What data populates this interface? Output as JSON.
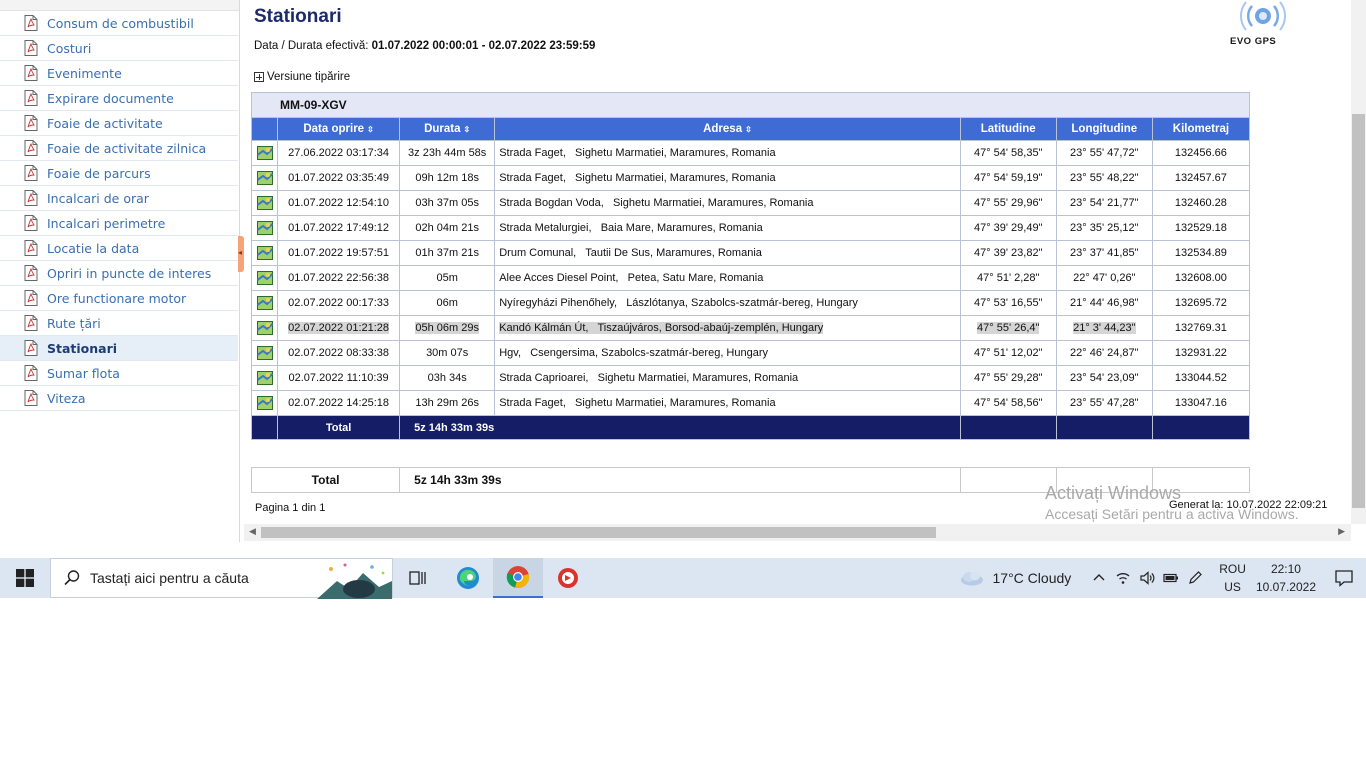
{
  "sidebar": {
    "items": [
      {
        "label": "Consum de combustibil",
        "active": false
      },
      {
        "label": "Costuri",
        "active": false
      },
      {
        "label": "Evenimente",
        "active": false
      },
      {
        "label": "Expirare documente",
        "active": false
      },
      {
        "label": "Foaie de activitate",
        "active": false
      },
      {
        "label": "Foaie de activitate zilnica",
        "active": false
      },
      {
        "label": "Foaie de parcurs",
        "active": false
      },
      {
        "label": "Incalcari de orar",
        "active": false
      },
      {
        "label": "Incalcari perimetre",
        "active": false
      },
      {
        "label": "Locatie la data",
        "active": false
      },
      {
        "label": "Opriri in puncte de interes",
        "active": false
      },
      {
        "label": "Ore functionare motor",
        "active": false
      },
      {
        "label": "Rute țări",
        "active": false
      },
      {
        "label": "Stationari",
        "active": true
      },
      {
        "label": "Sumar flota",
        "active": false
      },
      {
        "label": "Viteza",
        "active": false
      }
    ]
  },
  "page": {
    "title": "Stationari",
    "date_label": "Data / Durata efectivă:",
    "date_value": "01.07.2022 00:00:01 - 02.07.2022 23:59:59",
    "print_version": "Versiune tipărire",
    "logo_text": "EVO GPS",
    "pagination": "Pagina 1 din 1",
    "generated": "Generat la: 10.07.2022 22:09:21"
  },
  "report": {
    "vehicle": "MM-09-XGV",
    "columns": [
      "Data oprire",
      "Durata",
      "Adresa",
      "Latitudine",
      "Longitudine",
      "Kilometraj"
    ],
    "sort_glyph": "⇳",
    "rows": [
      {
        "date": "27.06.2022 03:17:34",
        "duration": "3z 23h 44m 58s",
        "address": "Strada Faget,   Sighetu Marmatiei, Maramures, Romania",
        "lat": "47° 54' 58,35\"",
        "lon": "23° 55' 47,72\"",
        "km": "132456.66",
        "highlight": false
      },
      {
        "date": "01.07.2022 03:35:49",
        "duration": "09h 12m 18s",
        "address": "Strada Faget,   Sighetu Marmatiei, Maramures, Romania",
        "lat": "47° 54' 59,19\"",
        "lon": "23° 55' 48,22\"",
        "km": "132457.67",
        "highlight": false
      },
      {
        "date": "01.07.2022 12:54:10",
        "duration": "03h 37m 05s",
        "address": "Strada Bogdan Voda,   Sighetu Marmatiei, Maramures, Romania",
        "lat": "47° 55' 29,96\"",
        "lon": "23° 54' 21,77\"",
        "km": "132460.28",
        "highlight": false
      },
      {
        "date": "01.07.2022 17:49:12",
        "duration": "02h 04m 21s",
        "address": "Strada Metalurgiei,   Baia Mare, Maramures, Romania",
        "lat": "47° 39' 29,49\"",
        "lon": "23° 35' 25,12\"",
        "km": "132529.18",
        "highlight": false
      },
      {
        "date": "01.07.2022 19:57:51",
        "duration": "01h 37m 21s",
        "address": "Drum Comunal,   Tautii De Sus, Maramures, Romania",
        "lat": "47° 39' 23,82\"",
        "lon": "23° 37' 41,85\"",
        "km": "132534.89",
        "highlight": false
      },
      {
        "date": "01.07.2022 22:56:38",
        "duration": "05m",
        "address": "Alee Acces Diesel Point,   Petea, Satu Mare, Romania",
        "lat": "47° 51' 2,28\"",
        "lon": "22° 47' 0,26\"",
        "km": "132608.00",
        "highlight": false
      },
      {
        "date": "02.07.2022 00:17:33",
        "duration": "06m",
        "address": "Nyíregyházi Pihenőhely,   Lászlótanya, Szabolcs-szatmár-bereg, Hungary",
        "lat": "47° 53' 16,55\"",
        "lon": "21° 44' 46,98\"",
        "km": "132695.72",
        "highlight": false
      },
      {
        "date": "02.07.2022 01:21:28",
        "duration": "05h 06m 29s",
        "address": "Kandó Kálmán Út,   Tiszaújváros, Borsod-abaúj-zemplén, Hungary",
        "lat": "47° 55' 26,4\"",
        "lon": "21° 3' 44,23\"",
        "km": "132769.31",
        "highlight": true
      },
      {
        "date": "02.07.2022 08:33:38",
        "duration": "30m 07s",
        "address": "Hgv,   Csengersima, Szabolcs-szatmár-bereg, Hungary",
        "lat": "47° 51' 12,02\"",
        "lon": "22° 46' 24,87\"",
        "km": "132931.22",
        "highlight": false
      },
      {
        "date": "02.07.2022 11:10:39",
        "duration": "03h 34s",
        "address": "Strada Caprioarei,   Sighetu Marmatiei, Maramures, Romania",
        "lat": "47° 55' 29,28\"",
        "lon": "23° 54' 23,09\"",
        "km": "133044.52",
        "highlight": false
      },
      {
        "date": "02.07.2022 14:25:18",
        "duration": "13h 29m 26s",
        "address": "Strada Faget,   Sighetu Marmatiei, Maramures, Romania",
        "lat": "47° 54' 58,56\"",
        "lon": "23° 55' 47,28\"",
        "km": "133047.16",
        "highlight": false
      }
    ],
    "total_label": "Total",
    "total_value": "5z 14h 33m 39s"
  },
  "grand_total": {
    "label": "Total",
    "value": "5z 14h 33m 39s"
  },
  "watermark": {
    "line1": "Activați Windows",
    "line2": "Accesați Setări pentru a activa Windows."
  },
  "taskbar": {
    "search_placeholder": "Tastați aici pentru a căuta",
    "weather": "17°C  Cloudy",
    "lang_top": "ROU",
    "lang_bottom": "US",
    "time": "22:10",
    "date": "10.07.2022"
  },
  "colors": {
    "header_blue": "#3e6cd4",
    "total_navy": "#151d66",
    "title_navy": "#1c2a6b",
    "link_blue": "#3a6fb0"
  }
}
